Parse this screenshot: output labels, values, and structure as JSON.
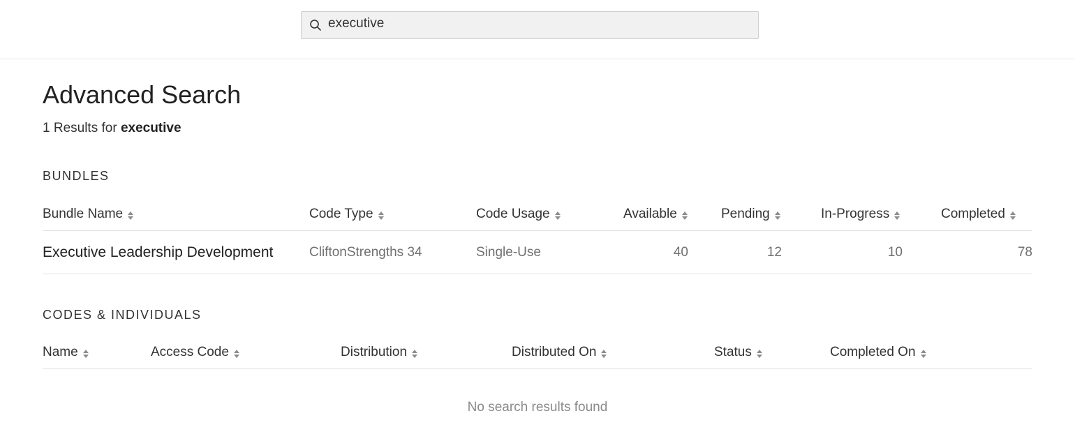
{
  "search": {
    "value": "executive",
    "placeholder": ""
  },
  "page": {
    "title": "Advanced Search",
    "results_count_text": "1 Results for ",
    "results_term": "executive"
  },
  "bundles": {
    "section_title": "BUNDLES",
    "columns": [
      "Bundle Name",
      "Code Type",
      "Code Usage",
      "Available",
      "Pending",
      "In-Progress",
      "Completed"
    ],
    "rows": [
      {
        "bundle_name": "Executive Leadership Development",
        "code_type": "CliftonStrengths 34",
        "code_usage": "Single-Use",
        "available": "40",
        "pending": "12",
        "in_progress": "10",
        "completed": "78"
      }
    ]
  },
  "codes": {
    "section_title": "CODES & INDIVIDUALS",
    "columns": [
      "Name",
      "Access Code",
      "Distribution",
      "Distributed On",
      "Status",
      "Completed On"
    ],
    "empty_message": "No search results found"
  },
  "icons": {
    "search": "search-icon",
    "sort": "sort-icon"
  }
}
